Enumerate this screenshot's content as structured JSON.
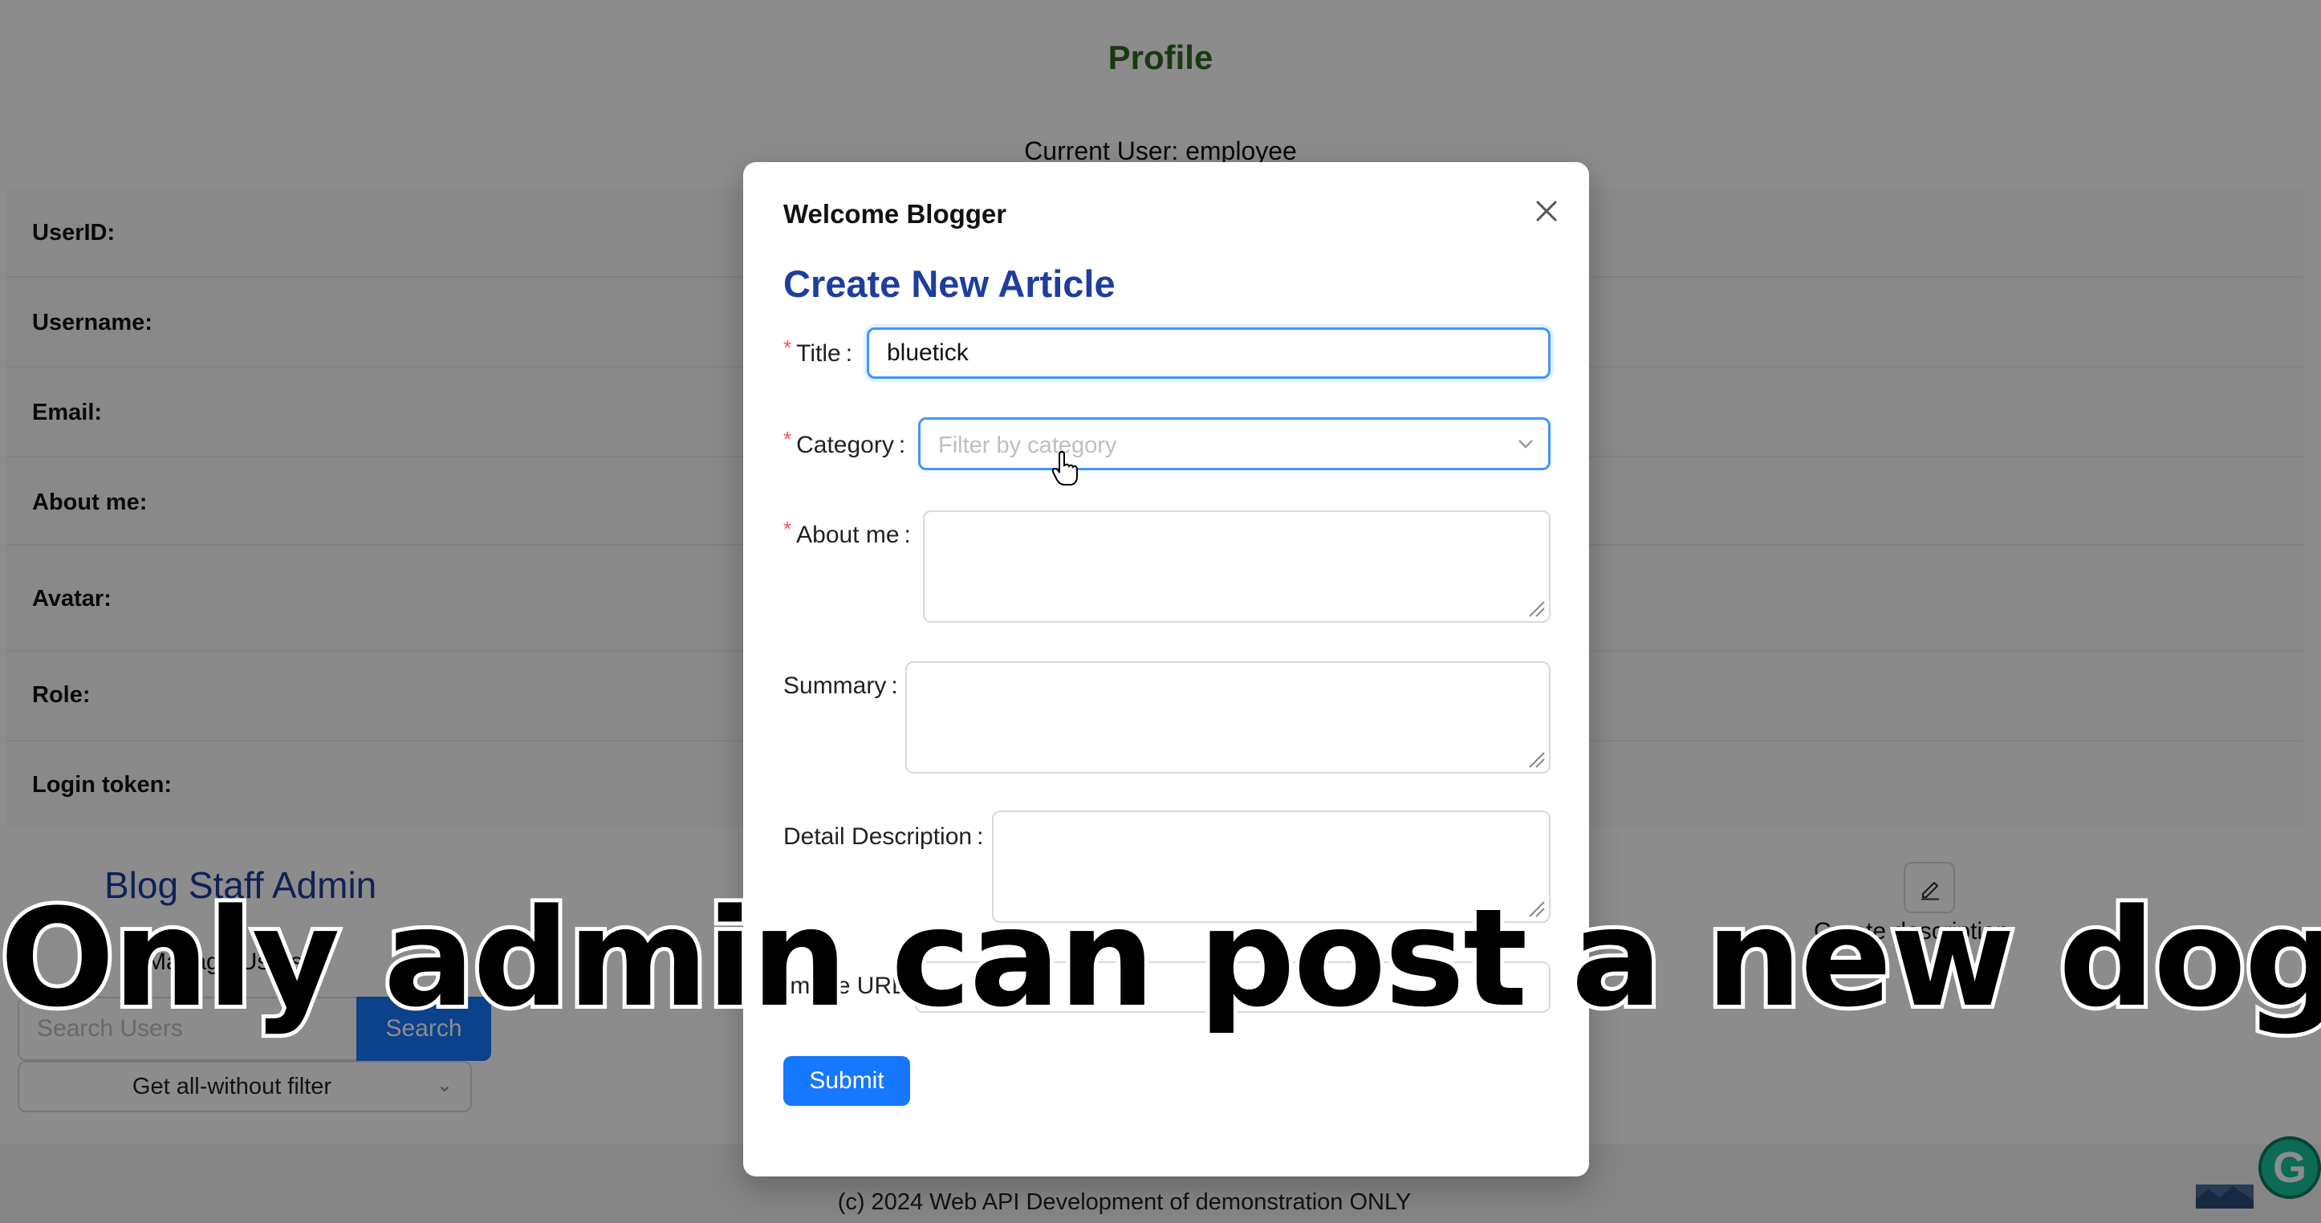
{
  "page": {
    "title": "Profile",
    "current_user": "Current User: employee",
    "fields": [
      "UserID:",
      "Username:",
      "Email:",
      "About me:",
      "Avatar:",
      "Role:",
      "Login token:"
    ],
    "admin_title": "Blog Staff Admin",
    "manage_users": "Manage Users",
    "search_placeholder": "Search Users",
    "search_button": "Search",
    "filter_value": "Get all-without filter",
    "create_description": "Create description",
    "footer": "(c) 2024 Web API Development of demonstration ONLY"
  },
  "modal": {
    "title": "Welcome Blogger",
    "heading": "Create New Article",
    "title_label": "Title",
    "title_value": "bluetick",
    "category_label": "Category",
    "category_placeholder": "Filter by category",
    "about_label": "About me",
    "summary_label": "Summary",
    "detail_label": "Detail Description",
    "image_url_label": "Image URL",
    "submit": "Submit"
  },
  "caption": "Only admin can post a new dog",
  "colors": {
    "primary": "#1677ff",
    "heading_blue": "#1d3e9e",
    "required_red": "#ff4d4f",
    "profile_green": "#2f6b1f"
  },
  "icons": [
    "close-icon",
    "chevron-down-icon",
    "hand-pointer-icon",
    "edit-icon",
    "grammarly-icon"
  ]
}
